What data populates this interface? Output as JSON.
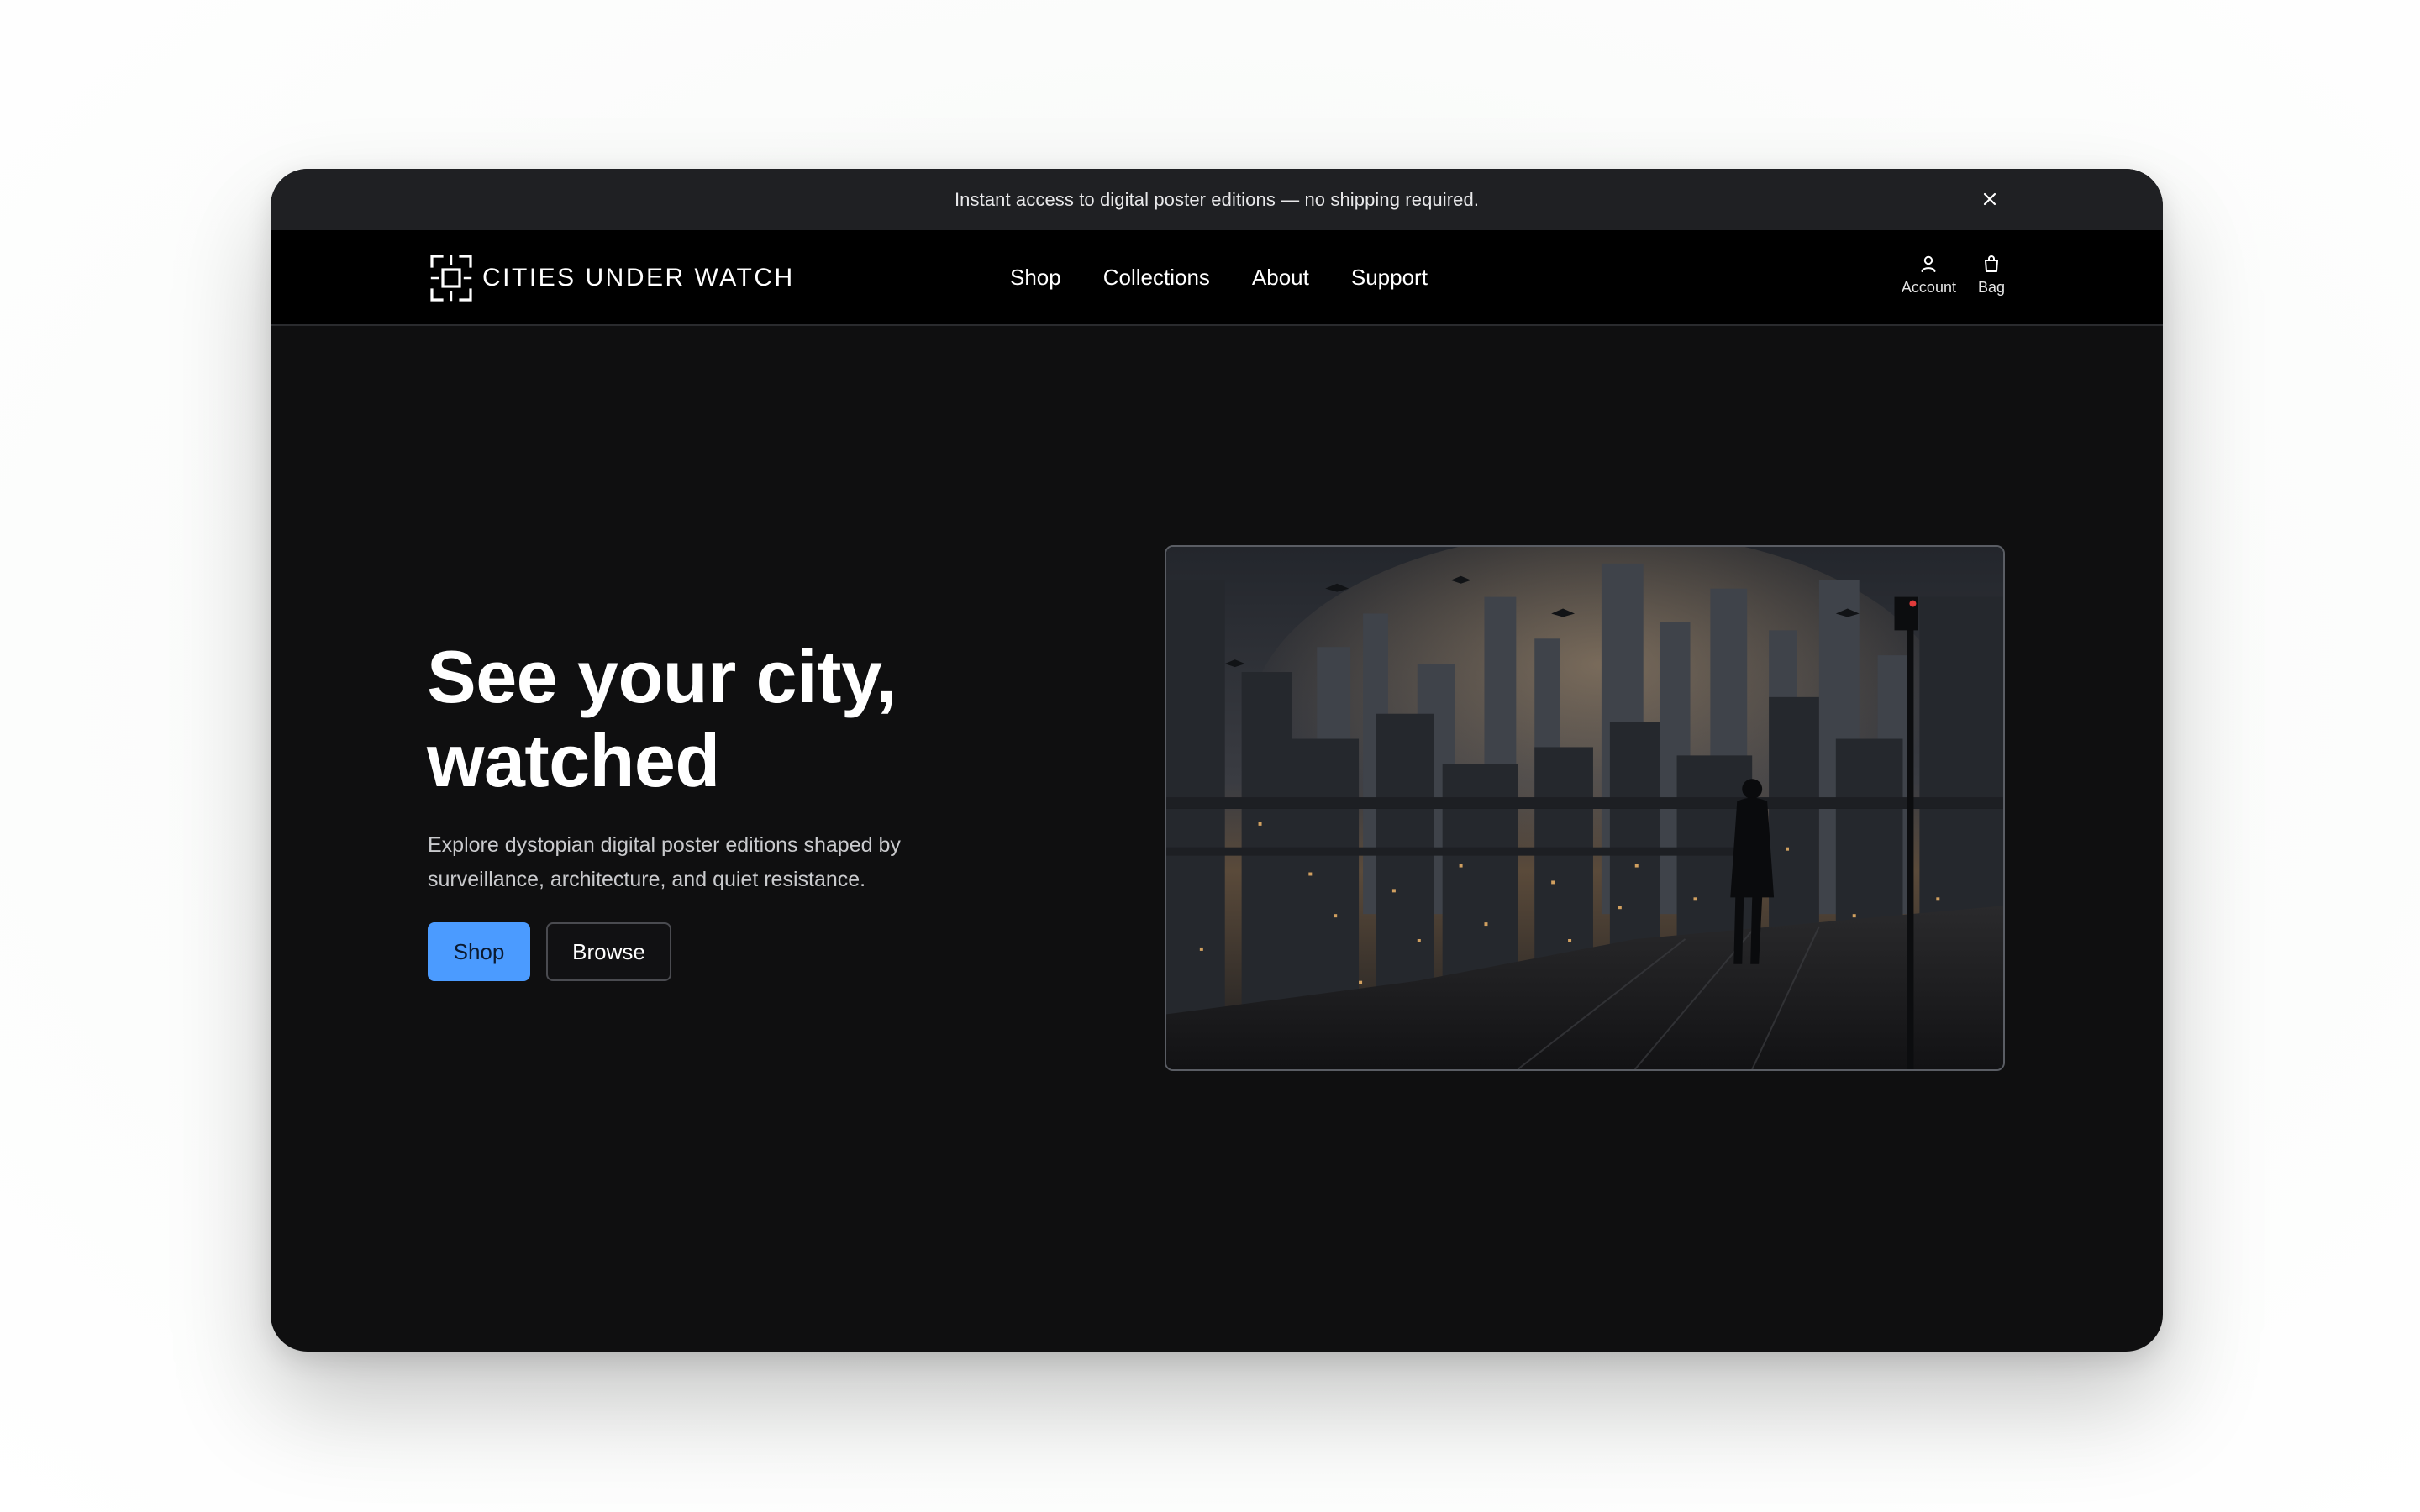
{
  "announcement": {
    "text": "Instant access to digital poster editions — no shipping required.",
    "close_icon": "close-icon"
  },
  "brand": {
    "name": "CITIES UNDER WATCH",
    "logo_icon": "focus-frame-icon"
  },
  "nav": {
    "links": [
      {
        "label": "Shop"
      },
      {
        "label": "Collections"
      },
      {
        "label": "About"
      },
      {
        "label": "Support"
      }
    ],
    "actions": [
      {
        "label": "Account",
        "icon": "user-icon"
      },
      {
        "label": "Bag",
        "icon": "shopping-bag-icon"
      }
    ]
  },
  "hero": {
    "title_line1": "See your city,",
    "title_line2": "watched",
    "subtitle": "Explore dystopian digital poster editions shaped by surveillance, architecture, and quiet resistance.",
    "primary_button": "Shop",
    "secondary_button": "Browse",
    "image": "Dystopian night cityscape with drones and a lone figure on a rooftop"
  },
  "colors": {
    "accent": "#4b9bff",
    "page_bg": "#0f0f10",
    "navbar_bg": "#000000",
    "announcement_bg": "#1f2023"
  }
}
